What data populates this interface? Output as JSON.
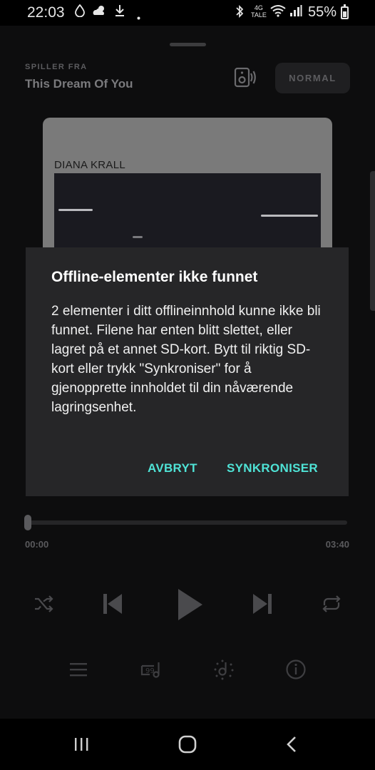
{
  "status_bar": {
    "time": "22:03",
    "network_label_top": "4G",
    "network_label_bottom": "TALE",
    "battery_percent": "55%"
  },
  "player": {
    "playing_from_label": "SPILLER FRA",
    "playing_from_title": "This Dream Of You",
    "mode_button": "NORMAL",
    "album_artist": "DIANA KRALL",
    "progress_fraction": 0.0,
    "time_elapsed": "00:00",
    "time_total": "03:40"
  },
  "dialog": {
    "title": "Offline-elementer ikke funnet",
    "body": "2 elementer i ditt offlineinnhold kunne ikke bli funnet. Filene har enten blitt slettet, eller lagret på et annet SD-kort. Bytt til riktig SD-kort eller trykk \"Synkroniser\" for å gjenopprette innholdet til din nåværende lagringsenhet.",
    "cancel_label": "AVBRYT",
    "sync_label": "SYNKRONISER"
  },
  "colors": {
    "accent": "#4fe3d6",
    "dialog_bg": "#262628",
    "player_bg": "#0d0d0e"
  },
  "icons": {
    "controls": [
      "shuffle-icon",
      "previous-icon",
      "play-icon",
      "next-icon",
      "repeat-icon"
    ],
    "bottom": [
      "queue-icon",
      "lyrics-icon",
      "credits-icon",
      "info-icon"
    ],
    "navigation": [
      "recent-apps-icon",
      "home-icon",
      "back-icon"
    ]
  }
}
